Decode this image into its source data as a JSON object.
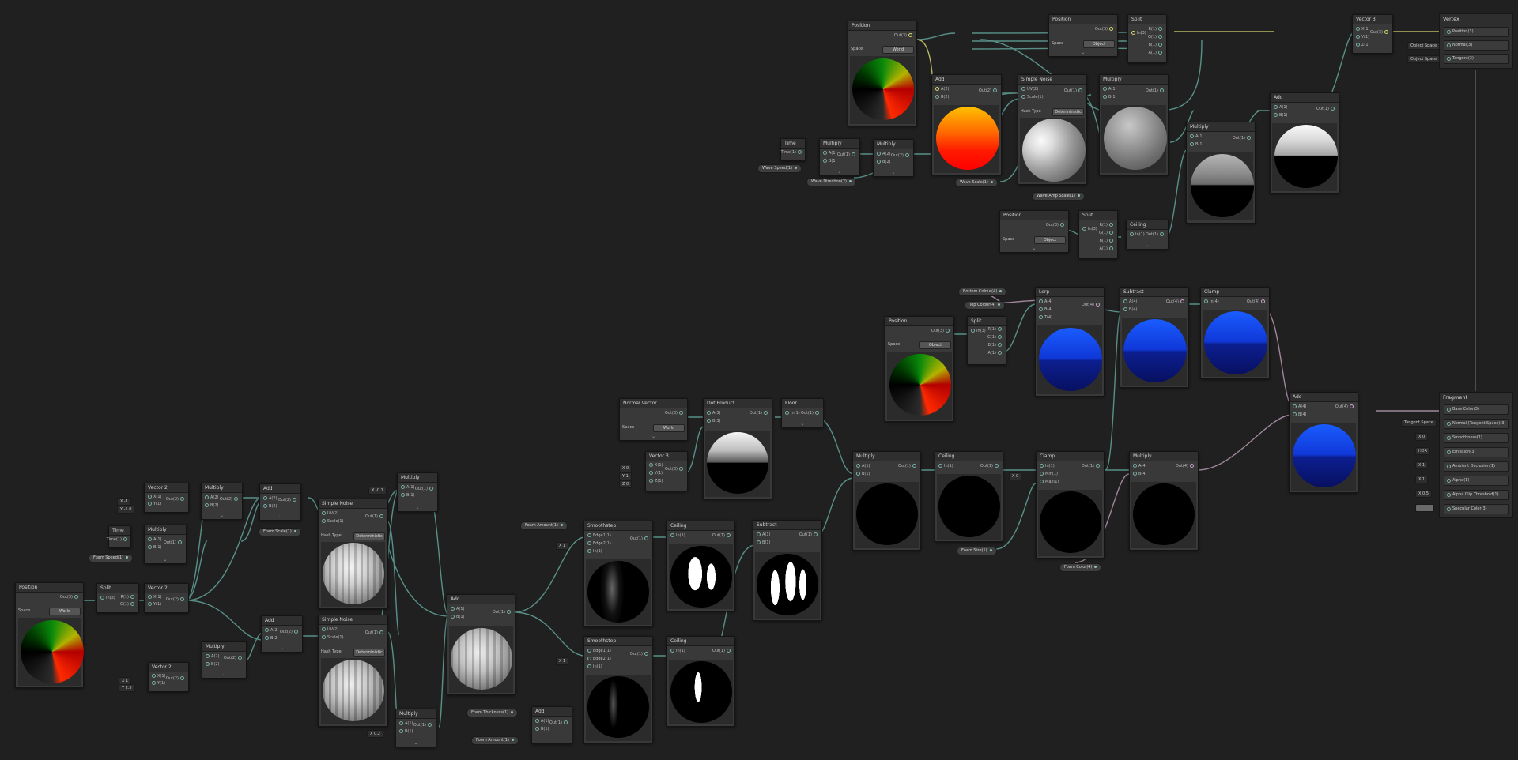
{
  "colors": {
    "bg": "#202020",
    "node": "#393939",
    "header": "#2f2f2f",
    "wire_vector": "#5f9d94",
    "wire_color": "#b79ab3",
    "wire_time": "#c6c66a",
    "accent": "#78b0a6"
  },
  "port_labels": {
    "out4": "Out(4)",
    "out3": "Out(3)",
    "out2": "Out(2)",
    "out1": "Out(1)",
    "a1": "A(1)",
    "b1": "B(1)",
    "a2": "A(2)",
    "b2": "B(2)",
    "a3": "A(3)",
    "b3": "B(3)",
    "a4": "A(4)",
    "b4": "B(4)",
    "in1": "In(1)",
    "in3": "In(3)",
    "in4": "In(4)",
    "in2": "In(2)",
    "r1": "R(1)",
    "g1": "G(1)",
    "bb1": "B(1)",
    "aa1": "A(1)",
    "x1": "X(1)",
    "y1": "Y(1)",
    "z1": "Z(1)",
    "uv2": "UV(2)",
    "scale1": "Scale(1)",
    "edge1": "Edge1(1)",
    "edge2": "Edge2(1)",
    "t4": "T(4)",
    "min1": "Min(1)",
    "max1": "Max(1)",
    "time1": "Time(1)"
  },
  "dropdowns": {
    "world": "World",
    "object": "Object",
    "deterministic": "Deterministic"
  },
  "labels": {
    "space": "Space",
    "hash_type": "Hash Type"
  },
  "node_titles": {
    "position": "Position",
    "split": "Split",
    "vector2": "Vector 2",
    "vector3": "Vector 3",
    "multiply": "Multiply",
    "add": "Add",
    "time": "Time",
    "simple_noise": "Simple Noise",
    "smoothstep": "Smoothstep",
    "ceiling": "Ceiling",
    "subtract": "Subtract",
    "normal_vector": "Normal Vector",
    "dot_product": "Dot Product",
    "floor": "Floor",
    "clamp": "Clamp",
    "lerp": "Lerp"
  },
  "properties": {
    "wave_speed": "Wave Speed(1)",
    "wave_direction": "Wave Direction(2)",
    "wave_scale": "Wave Scale(1)",
    "wave_amplitude": "Wave Amp Scale(1)",
    "bottom_colour": "Bottom Colour(4)",
    "top_colour": "Top Colour(4)",
    "foam_scale": "Foam Scale(1)",
    "foam_speed": "Foam Speed(1)",
    "foam_amount": "Foam Amount(1)",
    "foam_thickness": "Foam Thickness(1)",
    "foam_size": "Foam Size(1)",
    "foam_color": "Foam Color(4)"
  },
  "inline_values": {
    "x_neg1": "X -1",
    "y_neg1": "Y -1.0",
    "x_0_5": "X 0.5",
    "x_1": "X 1",
    "y_2_5": "Y 2.5",
    "x_0_1": "X -0.1",
    "x_0_2": "X 0.2",
    "x_0_3": "X 0.3",
    "v3_x": "X 0",
    "v3_y": "Y 1",
    "v3_z": "Z 0",
    "x_0": "X 0",
    "x1": "X 1",
    "y0": "Y 0"
  },
  "master": {
    "vertex": {
      "title": "Vertex",
      "rows": [
        "Position(3)",
        "Normal(3)",
        "Tangent(3)"
      ],
      "stack": [
        "Object Space",
        "Object Space"
      ]
    },
    "fragment": {
      "title": "Fragment",
      "rows": [
        "Base Color(3)",
        "Normal (Tangent Space)(3)",
        "Smoothness(1)",
        "Emission(3)",
        "Ambient Occlusion(1)",
        "Alpha(1)",
        "Alpha Clip Threshold(1)",
        "Specular Color(3)"
      ],
      "stack": [
        "Tangent Space",
        "X 0",
        "HDR",
        "X 1",
        "X 1",
        "X 0.5",
        ""
      ]
    }
  }
}
